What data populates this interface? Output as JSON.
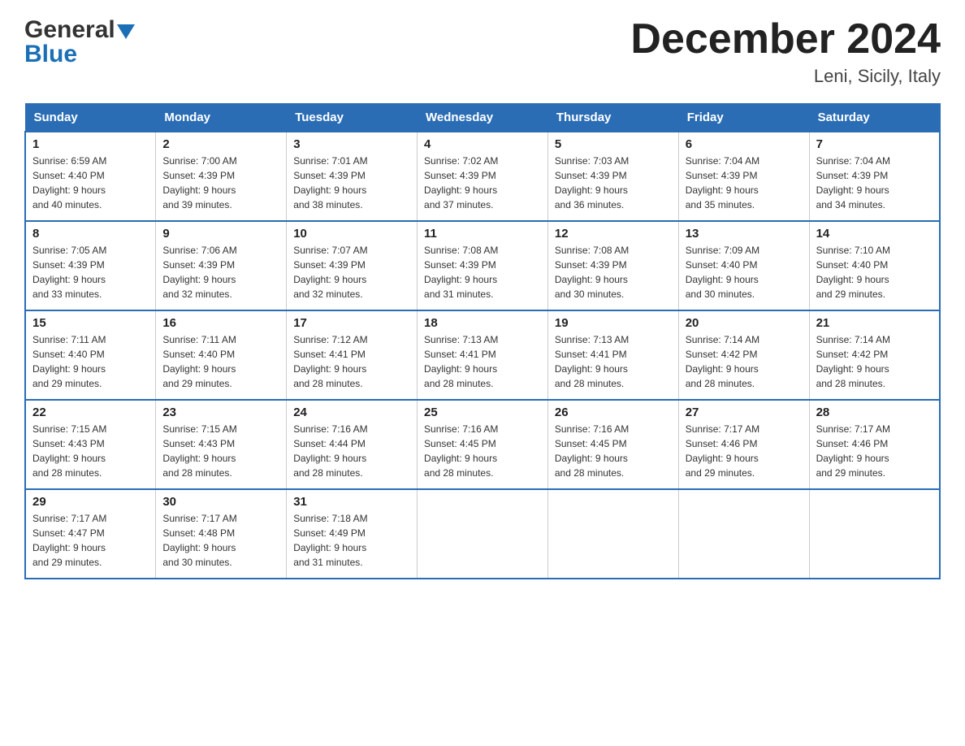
{
  "header": {
    "month_year": "December 2024",
    "location": "Leni, Sicily, Italy",
    "logo_general": "General",
    "logo_blue": "Blue"
  },
  "days_of_week": [
    "Sunday",
    "Monday",
    "Tuesday",
    "Wednesday",
    "Thursday",
    "Friday",
    "Saturday"
  ],
  "weeks": [
    [
      {
        "day": "1",
        "sunrise": "6:59 AM",
        "sunset": "4:40 PM",
        "daylight": "9 hours and 40 minutes."
      },
      {
        "day": "2",
        "sunrise": "7:00 AM",
        "sunset": "4:39 PM",
        "daylight": "9 hours and 39 minutes."
      },
      {
        "day": "3",
        "sunrise": "7:01 AM",
        "sunset": "4:39 PM",
        "daylight": "9 hours and 38 minutes."
      },
      {
        "day": "4",
        "sunrise": "7:02 AM",
        "sunset": "4:39 PM",
        "daylight": "9 hours and 37 minutes."
      },
      {
        "day": "5",
        "sunrise": "7:03 AM",
        "sunset": "4:39 PM",
        "daylight": "9 hours and 36 minutes."
      },
      {
        "day": "6",
        "sunrise": "7:04 AM",
        "sunset": "4:39 PM",
        "daylight": "9 hours and 35 minutes."
      },
      {
        "day": "7",
        "sunrise": "7:04 AM",
        "sunset": "4:39 PM",
        "daylight": "9 hours and 34 minutes."
      }
    ],
    [
      {
        "day": "8",
        "sunrise": "7:05 AM",
        "sunset": "4:39 PM",
        "daylight": "9 hours and 33 minutes."
      },
      {
        "day": "9",
        "sunrise": "7:06 AM",
        "sunset": "4:39 PM",
        "daylight": "9 hours and 32 minutes."
      },
      {
        "day": "10",
        "sunrise": "7:07 AM",
        "sunset": "4:39 PM",
        "daylight": "9 hours and 32 minutes."
      },
      {
        "day": "11",
        "sunrise": "7:08 AM",
        "sunset": "4:39 PM",
        "daylight": "9 hours and 31 minutes."
      },
      {
        "day": "12",
        "sunrise": "7:08 AM",
        "sunset": "4:39 PM",
        "daylight": "9 hours and 30 minutes."
      },
      {
        "day": "13",
        "sunrise": "7:09 AM",
        "sunset": "4:40 PM",
        "daylight": "9 hours and 30 minutes."
      },
      {
        "day": "14",
        "sunrise": "7:10 AM",
        "sunset": "4:40 PM",
        "daylight": "9 hours and 29 minutes."
      }
    ],
    [
      {
        "day": "15",
        "sunrise": "7:11 AM",
        "sunset": "4:40 PM",
        "daylight": "9 hours and 29 minutes."
      },
      {
        "day": "16",
        "sunrise": "7:11 AM",
        "sunset": "4:40 PM",
        "daylight": "9 hours and 29 minutes."
      },
      {
        "day": "17",
        "sunrise": "7:12 AM",
        "sunset": "4:41 PM",
        "daylight": "9 hours and 28 minutes."
      },
      {
        "day": "18",
        "sunrise": "7:13 AM",
        "sunset": "4:41 PM",
        "daylight": "9 hours and 28 minutes."
      },
      {
        "day": "19",
        "sunrise": "7:13 AM",
        "sunset": "4:41 PM",
        "daylight": "9 hours and 28 minutes."
      },
      {
        "day": "20",
        "sunrise": "7:14 AM",
        "sunset": "4:42 PM",
        "daylight": "9 hours and 28 minutes."
      },
      {
        "day": "21",
        "sunrise": "7:14 AM",
        "sunset": "4:42 PM",
        "daylight": "9 hours and 28 minutes."
      }
    ],
    [
      {
        "day": "22",
        "sunrise": "7:15 AM",
        "sunset": "4:43 PM",
        "daylight": "9 hours and 28 minutes."
      },
      {
        "day": "23",
        "sunrise": "7:15 AM",
        "sunset": "4:43 PM",
        "daylight": "9 hours and 28 minutes."
      },
      {
        "day": "24",
        "sunrise": "7:16 AM",
        "sunset": "4:44 PM",
        "daylight": "9 hours and 28 minutes."
      },
      {
        "day": "25",
        "sunrise": "7:16 AM",
        "sunset": "4:45 PM",
        "daylight": "9 hours and 28 minutes."
      },
      {
        "day": "26",
        "sunrise": "7:16 AM",
        "sunset": "4:45 PM",
        "daylight": "9 hours and 28 minutes."
      },
      {
        "day": "27",
        "sunrise": "7:17 AM",
        "sunset": "4:46 PM",
        "daylight": "9 hours and 29 minutes."
      },
      {
        "day": "28",
        "sunrise": "7:17 AM",
        "sunset": "4:46 PM",
        "daylight": "9 hours and 29 minutes."
      }
    ],
    [
      {
        "day": "29",
        "sunrise": "7:17 AM",
        "sunset": "4:47 PM",
        "daylight": "9 hours and 29 minutes."
      },
      {
        "day": "30",
        "sunrise": "7:17 AM",
        "sunset": "4:48 PM",
        "daylight": "9 hours and 30 minutes."
      },
      {
        "day": "31",
        "sunrise": "7:18 AM",
        "sunset": "4:49 PM",
        "daylight": "9 hours and 31 minutes."
      },
      null,
      null,
      null,
      null
    ]
  ],
  "labels": {
    "sunrise": "Sunrise:",
    "sunset": "Sunset:",
    "daylight": "Daylight:"
  }
}
